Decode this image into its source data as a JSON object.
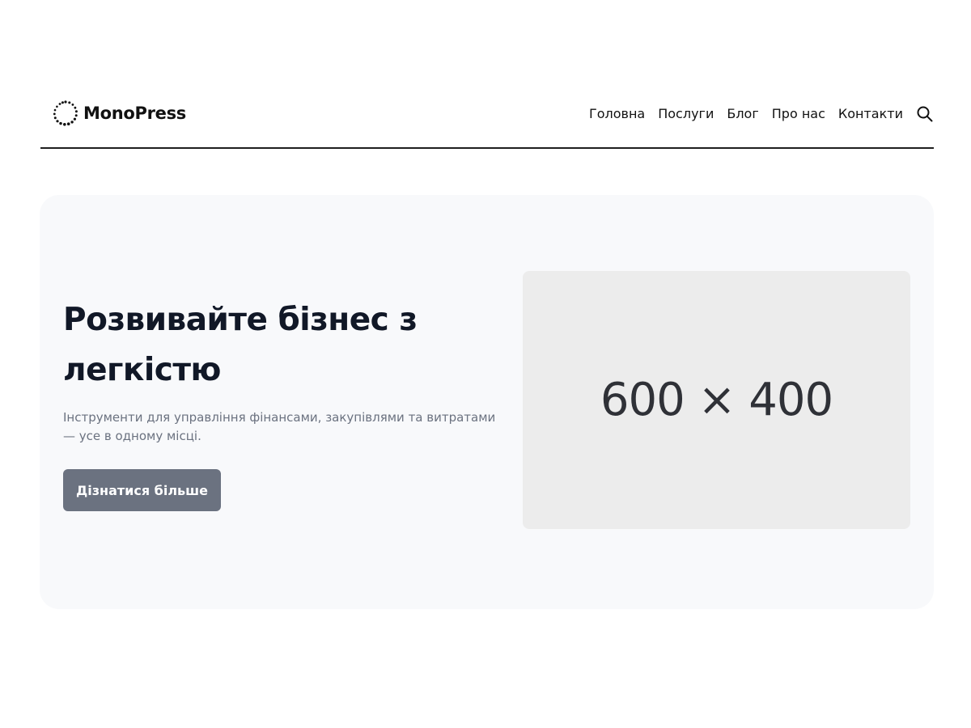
{
  "header": {
    "logo_text": "MonoPress",
    "logo_icon": "dotted-circle-icon",
    "nav": [
      {
        "label": "Головна"
      },
      {
        "label": "Послуги"
      },
      {
        "label": "Блог"
      },
      {
        "label": "Про нас"
      },
      {
        "label": "Контакти"
      }
    ],
    "search_icon": "search-icon"
  },
  "hero": {
    "title": "Розвивайте бізнес з легкістю",
    "description": "Інструменти для управління фінансами, закупівлями та витратами — усе в одному місці.",
    "button_label": "Дізнатися більше",
    "image_placeholder": "600 × 400"
  },
  "colors": {
    "text_primary": "#111827",
    "text_muted": "#6b7280",
    "hero_background": "#f8f9fb",
    "button_background": "#6b7280",
    "placeholder_background": "#ececec",
    "header_border": "#1f1f1f"
  }
}
